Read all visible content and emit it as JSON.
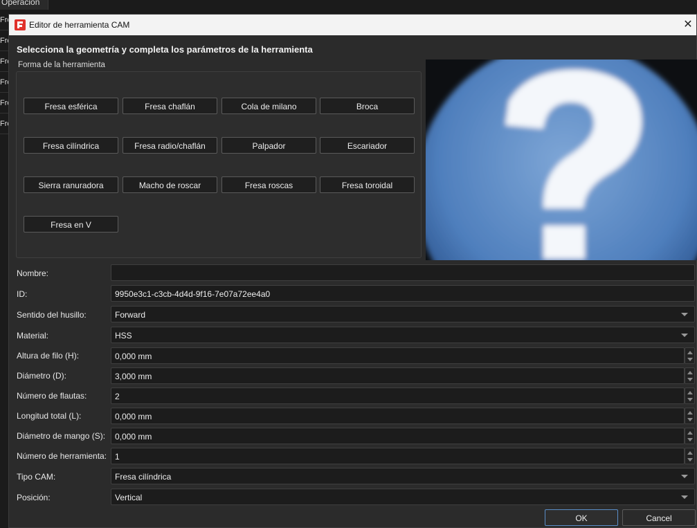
{
  "background": {
    "tab_label": "Operación",
    "list_items": [
      "Fres",
      "Fres",
      "Fres",
      "Fres",
      "Fres",
      "Fres"
    ]
  },
  "dialog": {
    "title": "Editor de herramienta CAM",
    "heading": "Selecciona la geometría y completa los parámetros de la herramienta",
    "group_label": "Forma de la herramienta",
    "shapes": [
      "Fresa esférica",
      "Fresa chaflán",
      "Cola de milano",
      "Broca",
      "Fresa cilíndrica",
      "Fresa radio/chaflán",
      "Palpador",
      "Escariador",
      "Sierra ranuradora",
      "Macho de roscar",
      "Fresa roscas",
      "Fresa toroidal",
      "Fresa en V"
    ],
    "preview_icon": "question-mark-icon",
    "fields": {
      "nombre": {
        "label": "Nombre:",
        "value": ""
      },
      "id": {
        "label": "ID:",
        "value": "9950e3c1-c3cb-4d4d-9f16-7e07a72ee4a0"
      },
      "sentido": {
        "label": "Sentido del husillo:",
        "value": "Forward"
      },
      "material": {
        "label": "Material:",
        "value": "HSS"
      },
      "altura": {
        "label": "Altura de filo (H):",
        "value": "0,000 mm"
      },
      "diametro": {
        "label": "Diámetro (D):",
        "value": "3,000 mm"
      },
      "flautas": {
        "label": "Número de flautas:",
        "value": "2"
      },
      "longitud": {
        "label": "Longitud total (L):",
        "value": "0,000 mm"
      },
      "mango": {
        "label": "Diámetro de mango (S):",
        "value": "0,000 mm"
      },
      "num_herramienta": {
        "label": "Número de herramienta:",
        "value": "1"
      },
      "tipo_cam": {
        "label": "Tipo CAM:",
        "value": "Fresa cilíndrica"
      },
      "posicion": {
        "label": "Posición:",
        "value": "Vertical"
      }
    },
    "ok_label": "OK",
    "cancel_label": "Cancel",
    "colors": {
      "accent": "#5a8ec9",
      "background": "#2b2b2b"
    }
  }
}
